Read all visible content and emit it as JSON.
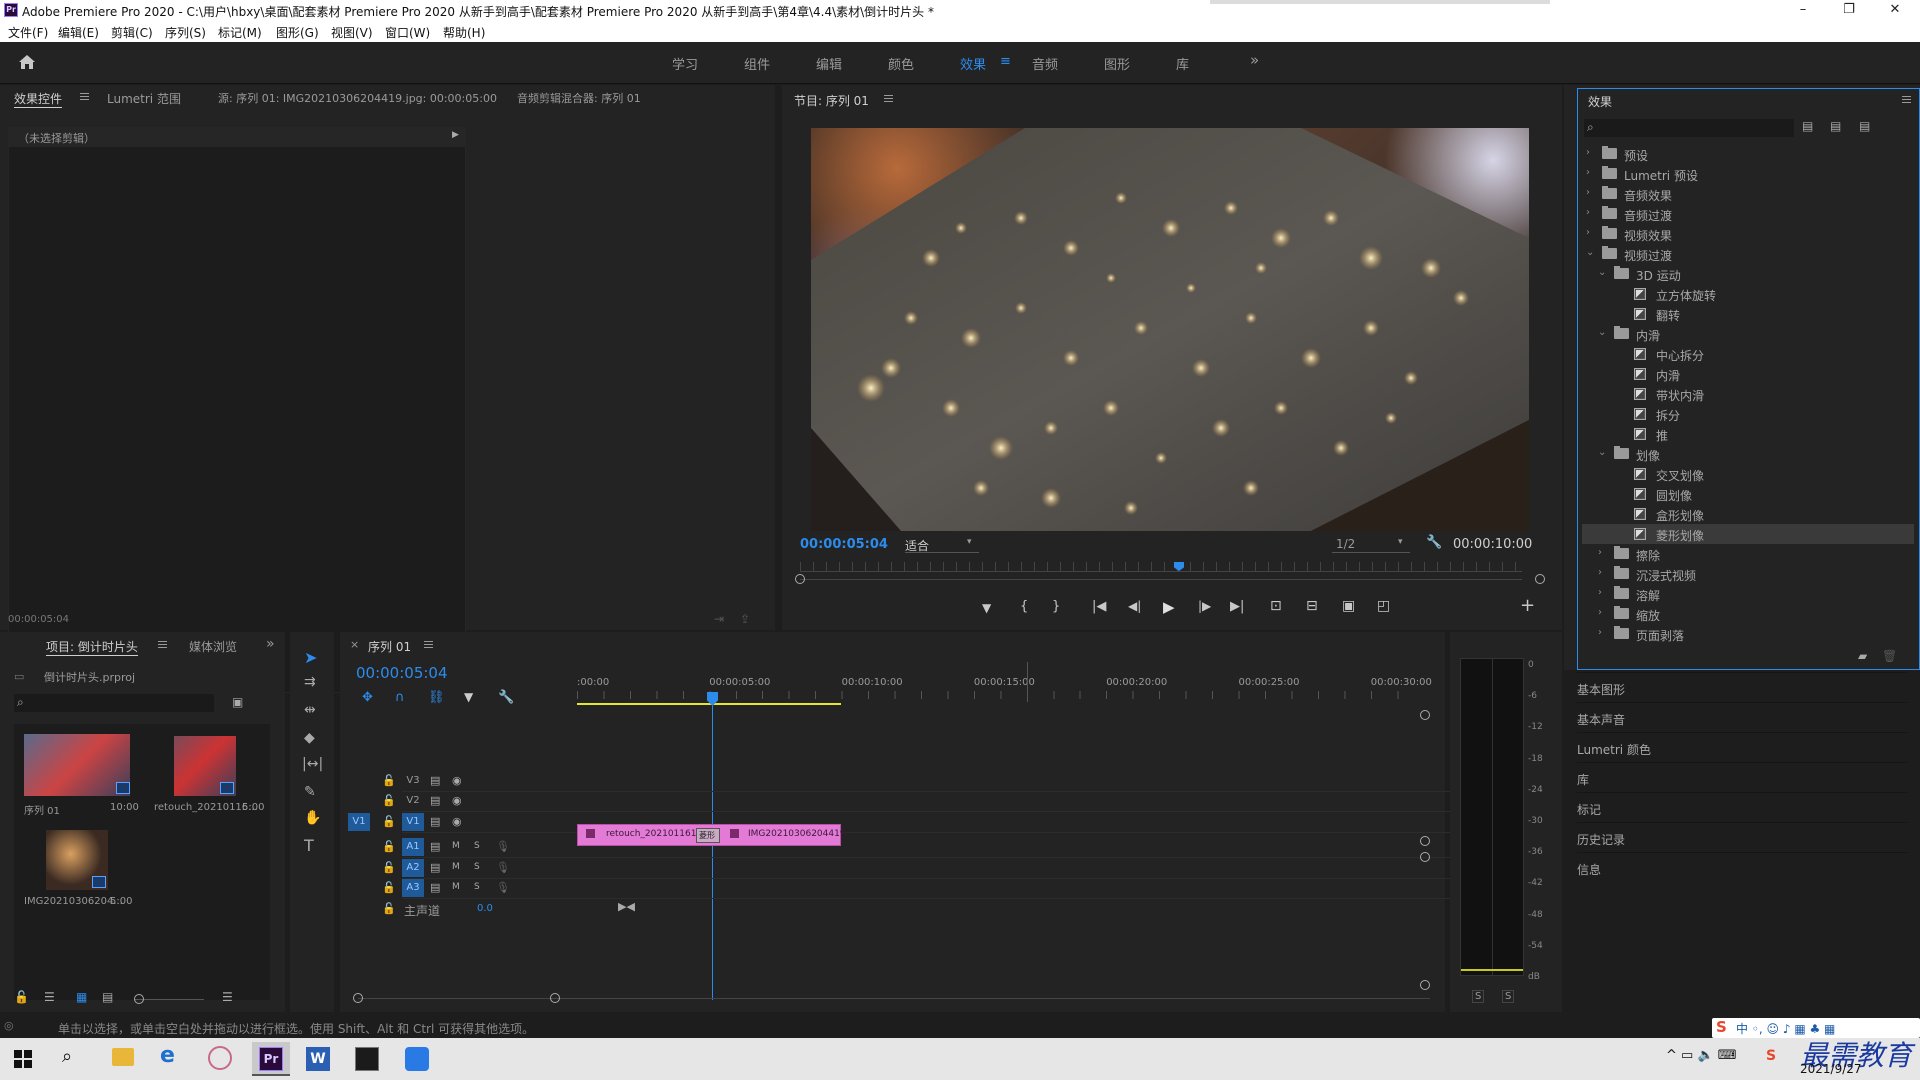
{
  "window": {
    "title": "Adobe Premiere Pro 2020 - C:\\用户\\hbxy\\桌面\\配套素材 Premiere Pro 2020 从新手到高手\\配套素材 Premiere Pro 2020 从新手到高手\\第4章\\4.4\\素材\\倒计时片头 *",
    "app_icon": "Pr"
  },
  "menu": [
    "文件(F)",
    "编辑(E)",
    "剪辑(C)",
    "序列(S)",
    "标记(M)",
    "图形(G)",
    "视图(V)",
    "窗口(W)",
    "帮助(H)"
  ],
  "workspaces": [
    "学习",
    "组件",
    "编辑",
    "颜色",
    "效果",
    "音频",
    "图形",
    "库"
  ],
  "active_workspace": "效果",
  "source_panel": {
    "tabs": [
      "效果控件",
      "Lumetri 范围",
      "源: 序列 01: IMG20210306204419.jpg: 00:00:05:00",
      "音频剪辑混合器: 序列 01"
    ],
    "no_clip": "（未选择剪辑）",
    "timecode": "00:00:05:04"
  },
  "program": {
    "title": "节目: 序列 01",
    "timecode": "00:00:05:04",
    "fit": "适合",
    "resolution": "1/2",
    "duration": "00:00:10:00"
  },
  "effects": {
    "title": "效果",
    "search_placeholder": "",
    "tree": [
      {
        "label": "预设",
        "level": 0,
        "type": "bin",
        "open": false
      },
      {
        "label": "Lumetri 预设",
        "level": 0,
        "type": "bin",
        "open": false
      },
      {
        "label": "音频效果",
        "level": 0,
        "type": "folder",
        "open": false
      },
      {
        "label": "音频过渡",
        "level": 0,
        "type": "folder",
        "open": false
      },
      {
        "label": "视频效果",
        "level": 0,
        "type": "folder",
        "open": false
      },
      {
        "label": "视频过渡",
        "level": 0,
        "type": "folder",
        "open": true
      },
      {
        "label": "3D 运动",
        "level": 1,
        "type": "folder",
        "open": true
      },
      {
        "label": "立方体旋转",
        "level": 2,
        "type": "fx"
      },
      {
        "label": "翻转",
        "level": 2,
        "type": "fx"
      },
      {
        "label": "内滑",
        "level": 1,
        "type": "folder",
        "open": true
      },
      {
        "label": "中心拆分",
        "level": 2,
        "type": "fx"
      },
      {
        "label": "内滑",
        "level": 2,
        "type": "fx"
      },
      {
        "label": "带状内滑",
        "level": 2,
        "type": "fx"
      },
      {
        "label": "拆分",
        "level": 2,
        "type": "fx"
      },
      {
        "label": "推",
        "level": 2,
        "type": "fx"
      },
      {
        "label": "划像",
        "level": 1,
        "type": "folder",
        "open": true
      },
      {
        "label": "交叉划像",
        "level": 2,
        "type": "fx"
      },
      {
        "label": "圆划像",
        "level": 2,
        "type": "fx"
      },
      {
        "label": "盒形划像",
        "level": 2,
        "type": "fx"
      },
      {
        "label": "菱形划像",
        "level": 2,
        "type": "fx",
        "selected": true
      },
      {
        "label": "擦除",
        "level": 1,
        "type": "folder",
        "open": false
      },
      {
        "label": "沉浸式视频",
        "level": 1,
        "type": "folder",
        "open": false
      },
      {
        "label": "溶解",
        "level": 1,
        "type": "folder",
        "open": false
      },
      {
        "label": "缩放",
        "level": 1,
        "type": "folder",
        "open": false
      },
      {
        "label": "页面剥落",
        "level": 1,
        "type": "folder",
        "open": false
      }
    ]
  },
  "side_panels": [
    "基本图形",
    "基本声音",
    "Lumetri 颜色",
    "库",
    "标记",
    "历史记录",
    "信息"
  ],
  "project": {
    "tabs": [
      "项目: 倒计时片头",
      "媒体浏览"
    ],
    "file": "倒计时片头.prproj",
    "items": [
      {
        "name": "序列 01",
        "duration": "10:00"
      },
      {
        "name": "retouch_20210116...",
        "duration": "5:00"
      },
      {
        "name": "IMG20210306204...",
        "duration": "5:00"
      }
    ]
  },
  "timeline": {
    "tab": "序列 01",
    "timecode": "00:00:05:04",
    "ruler": [
      ":00:00",
      "00:00:05:00",
      "00:00:10:00",
      "00:00:15:00",
      "00:00:20:00",
      "00:00:25:00",
      "00:00:30:00"
    ],
    "tracks": [
      "V3",
      "V2",
      "V1",
      "A1",
      "A2",
      "A3"
    ],
    "master_label": "主声道",
    "master_value": "0.0",
    "clip1": "retouch_2021011613",
    "transition": "菱形",
    "clip2": "IMG20210306204419"
  },
  "meter": {
    "scale": [
      "0",
      "-6",
      "-12",
      "-18",
      "-24",
      "-30",
      "-36",
      "-42",
      "-48",
      "-54",
      "dB"
    ],
    "solo": [
      "S",
      "S"
    ]
  },
  "status": "单击以选择，或单击空白处并拖动以进行框选。使用 Shift、Alt 和 Ctrl 可获得其他选项。",
  "taskbar": {
    "date": "2021/9/27",
    "watermark": "最需教育"
  },
  "colors": {
    "accent": "#2d8ceb",
    "clip": "#e37ad6",
    "panel": "#232323"
  }
}
